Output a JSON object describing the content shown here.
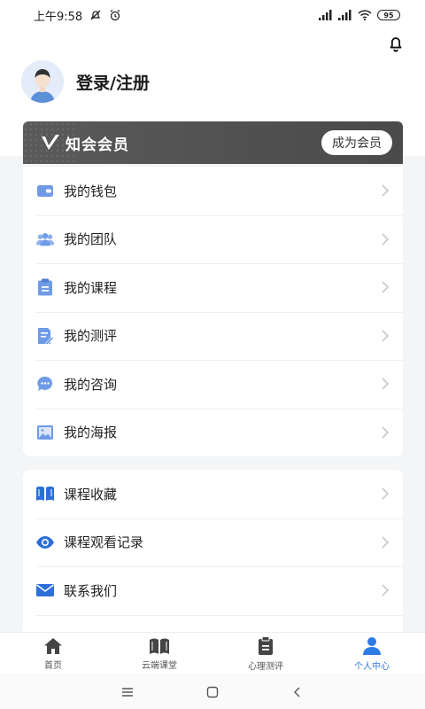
{
  "status": {
    "time": "上午9:58",
    "battery": "95"
  },
  "profile": {
    "login_label": "登录/注册"
  },
  "vip": {
    "title": "知会会员",
    "button": "成为会员"
  },
  "menu1": [
    {
      "label": "我的钱包",
      "icon": "wallet-icon"
    },
    {
      "label": "我的团队",
      "icon": "team-icon"
    },
    {
      "label": "我的课程",
      "icon": "clipboard-icon"
    },
    {
      "label": "我的测评",
      "icon": "edit-document-icon"
    },
    {
      "label": "我的咨询",
      "icon": "chat-bubble-icon"
    },
    {
      "label": "我的海报",
      "icon": "image-icon"
    }
  ],
  "menu2": [
    {
      "label": "课程收藏",
      "icon": "book-icon"
    },
    {
      "label": "课程观看记录",
      "icon": "eye-icon"
    },
    {
      "label": "联系我们",
      "icon": "envelope-icon"
    }
  ],
  "tabs": [
    {
      "label": "首页",
      "icon": "home-icon"
    },
    {
      "label": "云端课堂",
      "icon": "open-book-icon"
    },
    {
      "label": "心理测评",
      "icon": "clipboard-icon"
    },
    {
      "label": "个人中心",
      "icon": "person-icon"
    }
  ],
  "colors": {
    "accent": "#2d7be5",
    "icon_blue": "#6f9be6",
    "vip_bg": "#4f4f4f"
  }
}
